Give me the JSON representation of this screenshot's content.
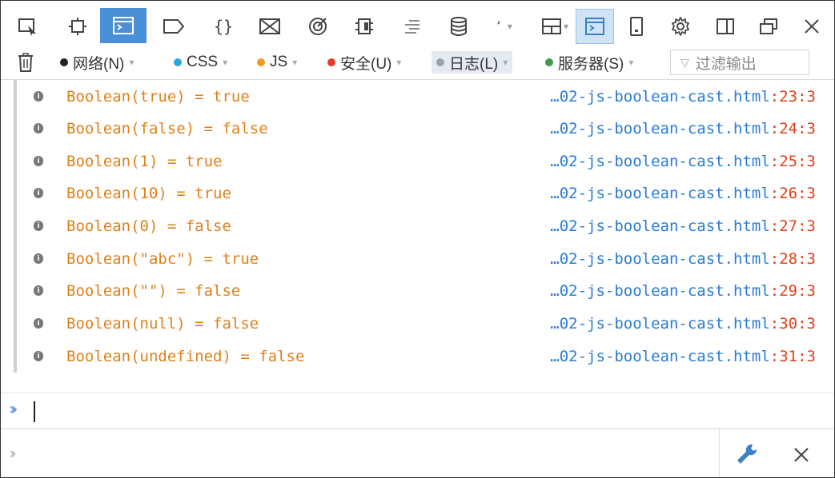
{
  "toolbar": {
    "tools": [
      {
        "icon": "element-picker-icon"
      },
      {
        "icon": "responsive-icon"
      },
      {
        "icon": "console-icon",
        "active": true
      },
      {
        "icon": "debugger-icon"
      },
      {
        "icon": "style-editor-icon"
      },
      {
        "icon": "performance-icon"
      },
      {
        "icon": "network-icon"
      },
      {
        "icon": "memory-icon"
      },
      {
        "icon": "storage-list-icon"
      },
      {
        "icon": "storage-icon"
      }
    ],
    "right_tools": [
      "split-layout-icon",
      "split-console-icon",
      "responsive-mode-icon",
      "settings-gear-icon",
      "dock-side-icon",
      "undock-window-icon",
      "close-icon"
    ]
  },
  "filters": {
    "clear_icon": "trash-icon",
    "items": [
      {
        "label": "网络(N)",
        "dot_color": "#222222"
      },
      {
        "label": "CSS",
        "dot_color": "#2aa9e0"
      },
      {
        "label": "JS",
        "dot_color": "#f29a1f"
      },
      {
        "label": "安全(U)",
        "dot_color": "#e53a2b"
      },
      {
        "label": "日志(L)",
        "dot_color": "#9aa3aa"
      },
      {
        "label": "服务器(S)",
        "dot_color": "#3f9a4a"
      }
    ],
    "search_placeholder": "过滤输出"
  },
  "logs": [
    {
      "message": "Boolean(true) = true",
      "source": "…02-js-boolean-cast.html",
      "line": ":23:3"
    },
    {
      "message": "Boolean(false) = false",
      "source": "…02-js-boolean-cast.html",
      "line": ":24:3"
    },
    {
      "message": "Boolean(1) = true",
      "source": "…02-js-boolean-cast.html",
      "line": ":25:3"
    },
    {
      "message": "Boolean(10) = true",
      "source": "…02-js-boolean-cast.html",
      "line": ":26:3"
    },
    {
      "message": "Boolean(0) = false",
      "source": "…02-js-boolean-cast.html",
      "line": ":27:3"
    },
    {
      "message": "Boolean(\"abc\") = true",
      "source": "…02-js-boolean-cast.html",
      "line": ":28:3"
    },
    {
      "message": "Boolean(\"\") = false",
      "source": "…02-js-boolean-cast.html",
      "line": ":29:3"
    },
    {
      "message": "Boolean(null) = false",
      "source": "…02-js-boolean-cast.html",
      "line": ":30:3"
    },
    {
      "message": "Boolean(undefined) = false",
      "source": "…02-js-boolean-cast.html",
      "line": ":31:3"
    }
  ],
  "colors": {
    "accent": "#4a90d9",
    "log_text": "#e0801a",
    "source_link": "#2a7bd4",
    "line_number": "#e0401a"
  },
  "command": {
    "prompt_icon": "chevron-double-right-icon",
    "value": ""
  }
}
